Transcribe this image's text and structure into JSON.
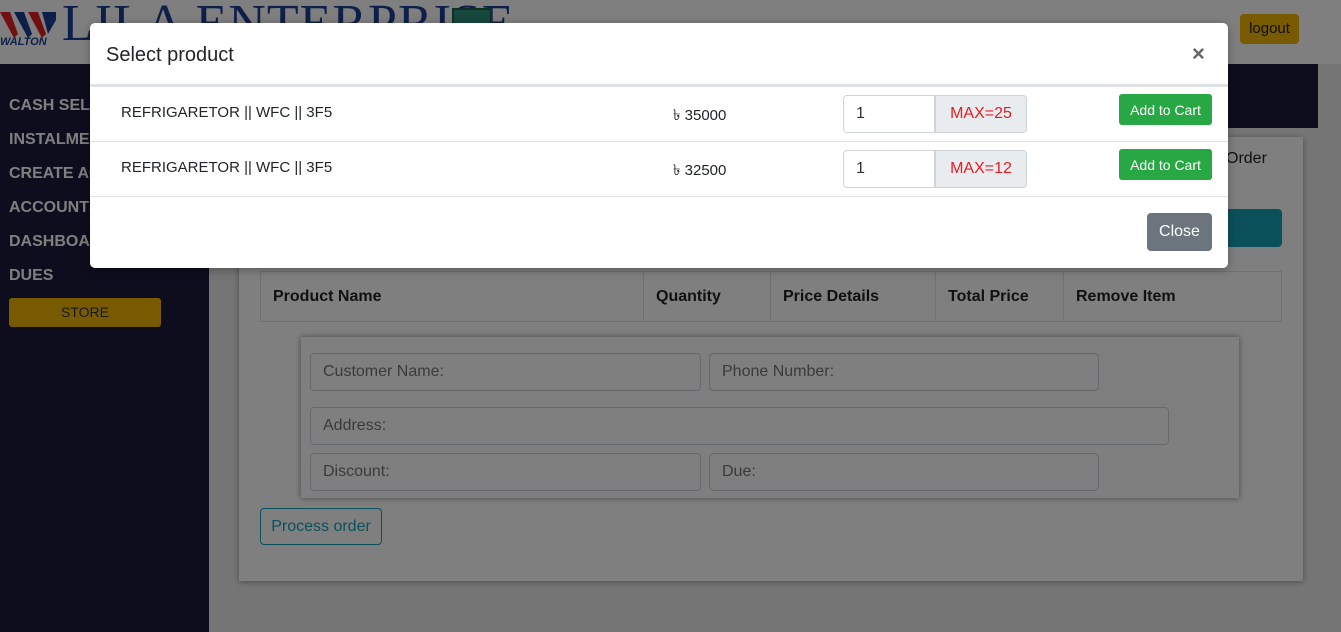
{
  "header": {
    "logo_text": "WALTON",
    "brand": "LILA ENTERPRISE",
    "refresh_icon": "refresh-icon",
    "logout_label": "logout"
  },
  "sidebar": {
    "items": [
      {
        "label": "CASH SELL"
      },
      {
        "label": "INSTALMENT"
      },
      {
        "label": "CREATE ACCOUNT"
      },
      {
        "label": "ACCOUNTS"
      },
      {
        "label": "DASHBOARD"
      },
      {
        "label": "DUES"
      }
    ],
    "store_label": "STORE"
  },
  "main": {
    "order_tab": "Order",
    "table_headers": [
      "Product Name",
      "Quantity",
      "Price Details",
      "Total Price",
      "Remove Item"
    ],
    "form": {
      "customer_name_placeholder": "Customer Name:",
      "phone_placeholder": "Phone Number:",
      "address_placeholder": "Address:",
      "discount_placeholder": "Discount:",
      "due_placeholder": "Due:"
    },
    "process_label": "Process order"
  },
  "modal": {
    "title": "Select product",
    "close_symbol": "×",
    "products": [
      {
        "name": "REFRIGARETOR || WFC || 3F5",
        "price": "৳ 35000",
        "qty": "1",
        "max": "MAX=25",
        "add_label": "Add to Cart"
      },
      {
        "name": "REFRIGARETOR || WFC || 3F5",
        "price": "৳ 32500",
        "qty": "1",
        "max": "MAX=12",
        "add_label": "Add to Cart"
      }
    ],
    "close_label": "Close"
  },
  "colors": {
    "sidebar_bg": "#1a1a3a",
    "accent_yellow": "#f0b400",
    "success_green": "#28a745",
    "teal": "#17a2b8",
    "max_red": "#e51c23"
  }
}
